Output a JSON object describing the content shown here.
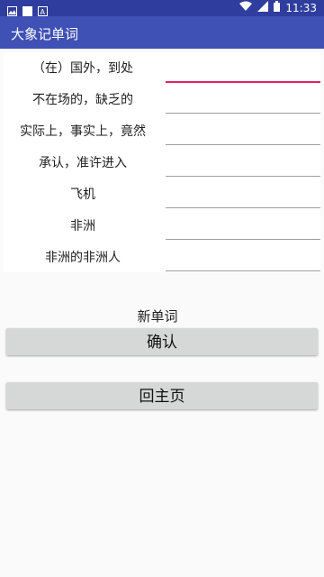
{
  "status_bar": {
    "time": "11:33",
    "left_icons": [
      "image-icon",
      "square-icon",
      "font-icon"
    ],
    "right_icons": [
      "wifi-icon",
      "signal-icon",
      "battery-icon"
    ]
  },
  "app_bar": {
    "title": "大象记单词"
  },
  "words": [
    {
      "label": "（在）国外，到处",
      "value": ""
    },
    {
      "label": "不在场的，缺乏的",
      "value": ""
    },
    {
      "label": "实际上，事实上，竟然",
      "value": ""
    },
    {
      "label": "承认，准许进入",
      "value": ""
    },
    {
      "label": "飞机",
      "value": ""
    },
    {
      "label": "非洲",
      "value": ""
    },
    {
      "label": "非洲的非洲人",
      "value": ""
    }
  ],
  "new_word_label": "新单词",
  "buttons": {
    "confirm": "确认",
    "home": "回主页"
  },
  "colors": {
    "status_bar": "#2f3e9e",
    "app_bar": "#3f51b5",
    "focus_accent": "#e91e63",
    "button_bg": "#d6d7d7"
  }
}
